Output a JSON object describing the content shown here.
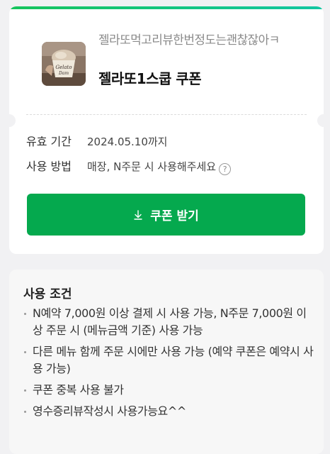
{
  "coupon": {
    "subtitle": "젤라또먹고리뷰한번정도는괜찮잖아ㅋ",
    "title": "젤라또1스쿱 쿠폰",
    "thumbnail_icon": "gelato-cup-photo",
    "expiry_label": "유효 기간",
    "expiry_value": "2024.05.10까지",
    "usage_label": "사용 방법",
    "usage_value": "매장, N주문 시 사용해주세요",
    "help_icon": "question-circle-icon",
    "download_icon": "download-icon",
    "button_label": "쿠폰 받기",
    "accent_color": "#05a94e"
  },
  "conditions": {
    "title": "사용 조건",
    "items": [
      "N예약 7,000원 이상 결제 시 사용 가능, N주문 7,000원 이상 주문 시 (메뉴금액 기준) 사용 가능",
      "다른 메뉴 함께 주문 시에만 사용 가능 (예약 쿠폰은 예약시 사용 가능)",
      "쿠폰 중복 사용 불가",
      "영수증리뷰작성시 사용가능요^^"
    ]
  }
}
